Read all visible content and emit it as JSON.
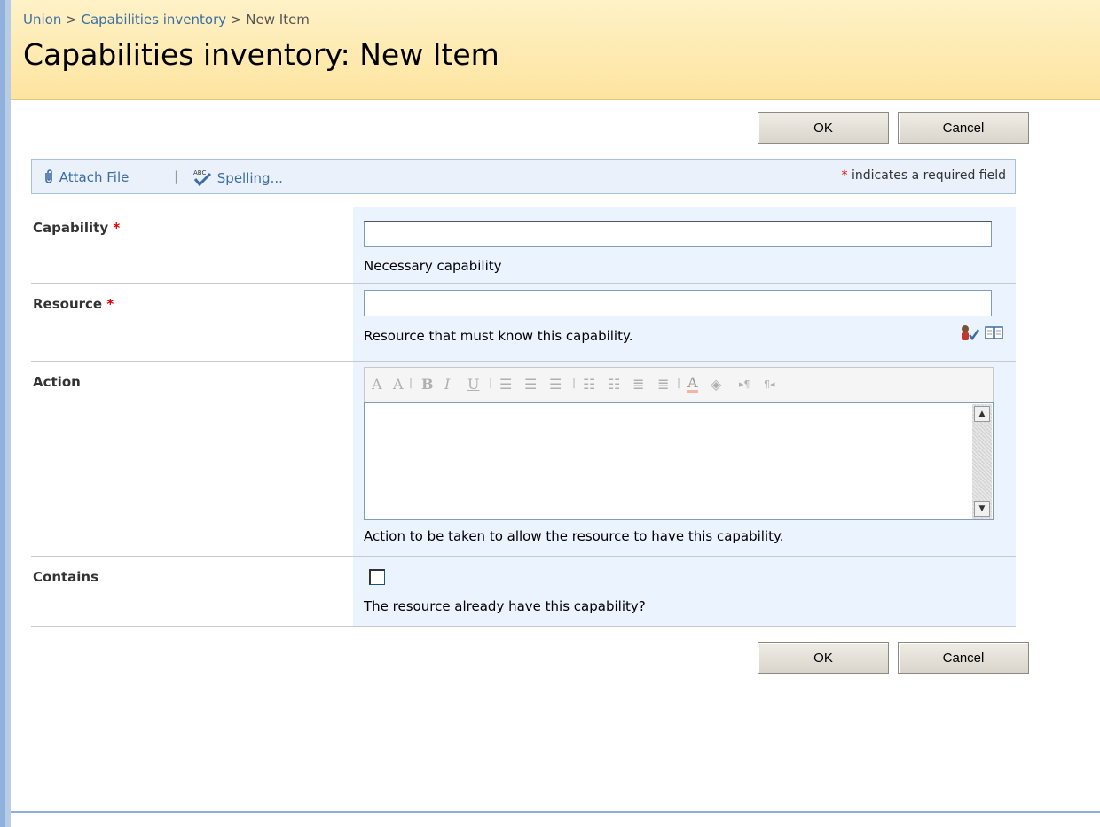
{
  "breadcrumb": {
    "items": [
      "Union",
      "Capabilities inventory",
      "New Item"
    ],
    "separator": ">"
  },
  "page": {
    "title": "Capabilities inventory: New Item"
  },
  "buttons": {
    "ok": "OK",
    "cancel": "Cancel"
  },
  "toolbar": {
    "attach": "Attach File",
    "divider": "|",
    "spelling": "Spelling...",
    "required_note": "indicates a required field",
    "required_mark": "*"
  },
  "fields": {
    "capability": {
      "label": "Capability",
      "value": "",
      "description": "Necessary capability"
    },
    "resource": {
      "label": "Resource",
      "value": "",
      "description": "Resource that must know this capability."
    },
    "action": {
      "label": "Action",
      "value": "",
      "description": "Action to be taken to allow the resource to have this capability."
    },
    "contains": {
      "label": "Contains",
      "checked": false,
      "description": "The resource already have this capability?"
    }
  },
  "rte_toolbar": [
    "A",
    "A",
    "B",
    "I",
    "U",
    "left-align",
    "center",
    "right-align",
    "numbered-list",
    "bullet-list",
    "outdent",
    "indent",
    "text-color",
    "bg-color",
    "ltr",
    "rtl"
  ],
  "colors": {
    "header_bg": "#fde49f",
    "link": "#3b6ea5",
    "field_bg": "#ebf3ff",
    "required": "#dd0000"
  }
}
